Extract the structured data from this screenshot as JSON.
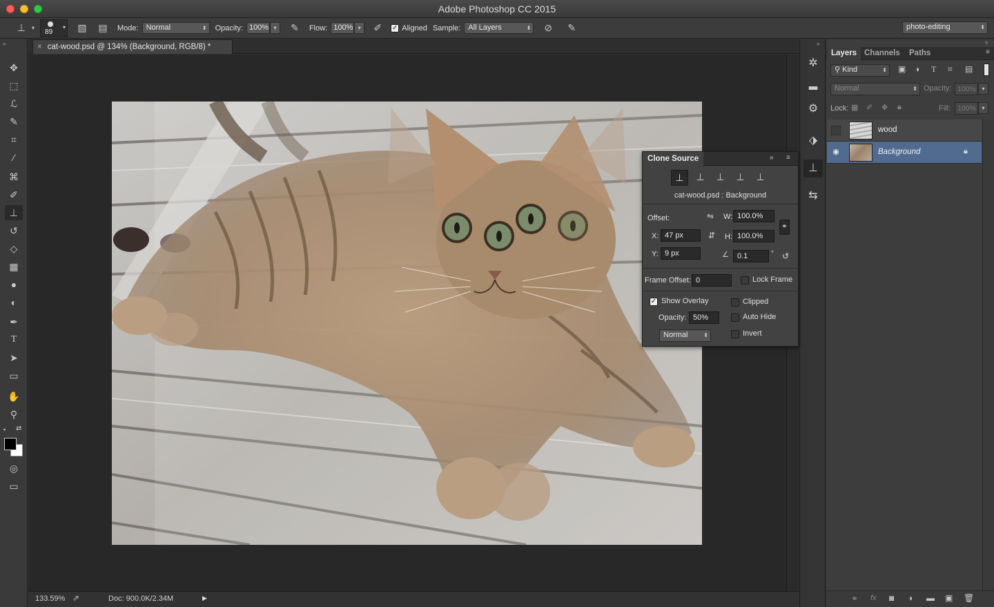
{
  "window": {
    "title": "Adobe Photoshop CC 2015"
  },
  "options_bar": {
    "brush_size": "89",
    "mode_label": "Mode:",
    "mode_value": "Normal",
    "opacity_label": "Opacity:",
    "opacity_value": "100%",
    "flow_label": "Flow:",
    "flow_value": "100%",
    "aligned_label": "Aligned",
    "aligned_checked": true,
    "sample_label": "Sample:",
    "sample_value": "All Layers",
    "workspace_value": "photo-editing"
  },
  "document": {
    "tab_title": "cat-wood.psd @ 134% (Background, RGB/8) *",
    "zoom": "133.59%",
    "doc_info": "Doc: 900.0K/2.34M"
  },
  "layers_panel": {
    "tabs": [
      "Layers",
      "Channels",
      "Paths"
    ],
    "filter_label": "Kind",
    "blend_mode": "Normal",
    "opacity_label": "Opacity:",
    "opacity_value": "100%",
    "lock_label": "Lock:",
    "fill_label": "Fill:",
    "fill_value": "100%",
    "layers": [
      {
        "name": "wood",
        "visible": false,
        "selected": false
      },
      {
        "name": "Background",
        "visible": true,
        "selected": true,
        "locked": true
      }
    ]
  },
  "clone_source": {
    "title": "Clone Source",
    "source_name": "cat-wood.psd : Background",
    "offset_label": "Offset:",
    "w_label": "W:",
    "w_value": "100.0%",
    "h_label": "H:",
    "h_value": "100.0%",
    "x_label": "X:",
    "x_value": "47 px",
    "y_label": "Y:",
    "y_value": "9 px",
    "angle_value": "0.1",
    "angle_unit": "°",
    "frame_offset_label": "Frame Offset:",
    "frame_offset_value": "0",
    "lock_frame_label": "Lock Frame",
    "show_overlay_label": "Show Overlay",
    "show_overlay_checked": true,
    "overlay_opacity_label": "Opacity:",
    "overlay_opacity_value": "50%",
    "overlay_mode": "Normal",
    "clipped_label": "Clipped",
    "auto_hide_label": "Auto Hide",
    "invert_label": "Invert"
  },
  "colors": {
    "accent_selected_row": "#506b8f",
    "close": "#fc5f57",
    "minimize": "#fdbc2e",
    "zoom": "#33c748"
  },
  "icons": [
    "move-icon",
    "marquee-icon",
    "lasso-icon",
    "quick-select-icon",
    "crop-icon",
    "eyedropper-icon",
    "healing-brush-icon",
    "brush-icon",
    "clone-stamp-icon",
    "history-brush-icon",
    "eraser-icon",
    "gradient-icon",
    "blur-icon",
    "dodge-icon",
    "pen-icon",
    "type-icon",
    "path-select-icon",
    "rectangle-icon",
    "hand-icon",
    "zoom-icon"
  ]
}
